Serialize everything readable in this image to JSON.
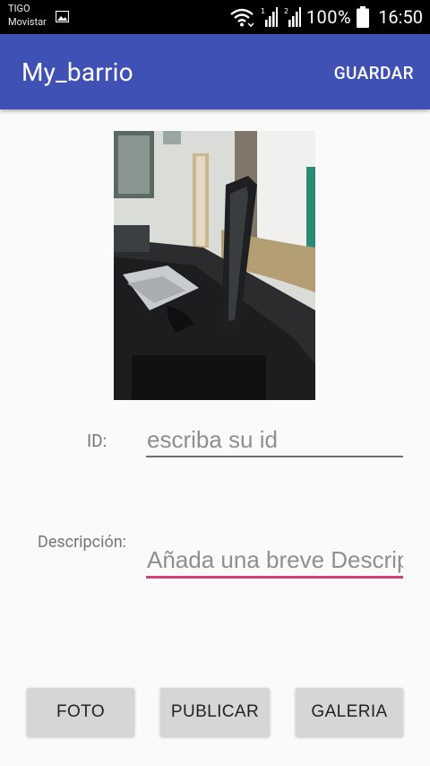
{
  "status_bar": {
    "carrier_line1": "TIGO",
    "carrier_line2": "Movistar",
    "battery": "100%",
    "time": "16:50",
    "icons": [
      "image-icon",
      "wifi-icon",
      "signal-sim1-icon",
      "signal-sim2-icon",
      "battery-icon"
    ]
  },
  "app_bar": {
    "title": "My_barrio",
    "action_label": "GUARDAR",
    "color": "#3f51b5"
  },
  "form": {
    "id_label": "ID:",
    "id_placeholder": "escriba su id",
    "id_value": "",
    "desc_label": "Descripción:",
    "desc_placeholder": "Añada una breve Descripción",
    "desc_value": "",
    "focus_color": "#d6407a"
  },
  "buttons": {
    "foto": "FOTO",
    "publicar": "PUBLICAR",
    "galeria": "GALERIA"
  }
}
